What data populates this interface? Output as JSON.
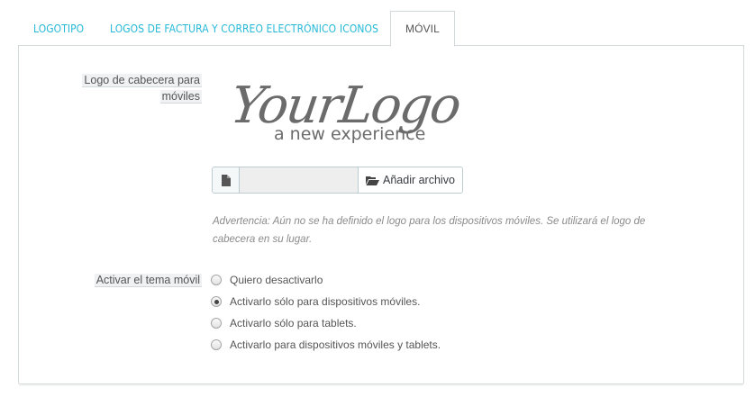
{
  "tabs": [
    {
      "label": "LOGOTIPO",
      "active": false
    },
    {
      "label": "LOGOS DE FACTURA Y CORREO ELECTRÓNICO",
      "active": false
    },
    {
      "label": "ICONOS",
      "active": false
    },
    {
      "label": "MÓVIL",
      "active": true
    }
  ],
  "form": {
    "header_logo_label_line1": "Logo de cabecera para",
    "header_logo_label_line2": "móviles",
    "logo": {
      "main_text": "YourLogo",
      "tagline": "a new experience"
    },
    "file_input": {
      "file_icon": "file-icon",
      "button_icon": "folder-open-icon",
      "button_label": "Añadir archivo"
    },
    "warning_line1": "Advertencia: Aún no se ha definido el logo para los dispositivos móviles. Se utilizará el logo de",
    "warning_line2": "cabecera en su lugar.",
    "mobile_theme_label": "Activar el tema móvil",
    "mobile_theme_options": [
      {
        "label": "Quiero desactivarlo",
        "checked": false
      },
      {
        "label": "Activarlo sólo para dispositivos móviles.",
        "checked": true
      },
      {
        "label": "Activarlo sólo para tablets.",
        "checked": false
      },
      {
        "label": "Activarlo para dispositivos móviles y tablets.",
        "checked": false
      }
    ]
  },
  "colors": {
    "accent": "#25b9d7",
    "label_bg": "#eff1f2",
    "border": "#d3d8db"
  }
}
